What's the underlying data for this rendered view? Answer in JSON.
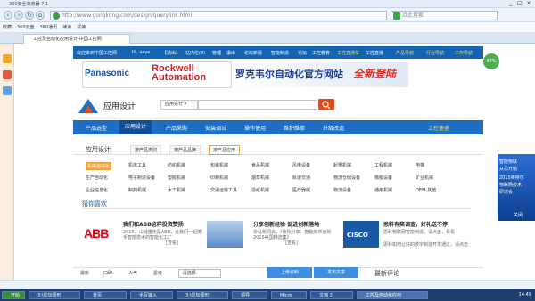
{
  "browser": {
    "title": "360安全浏览器 7.1",
    "address": "http://www.gongkong.com/design/querylink.html",
    "search_placeholder": "点此搜索",
    "favorites": [
      "收藏",
      "360云盘",
      "360通讯",
      "读读",
      "试读"
    ],
    "tab_label": "工控及自动化应用设计-中国工控网",
    "window_controls": [
      "_",
      "□",
      "×"
    ]
  },
  "top_strip": {
    "links": [
      "欢迎来到中国工控网",
      "Hi, vaye",
      "【退出】",
      "站内信(0)",
      "管理",
      "退出",
      "论坛新版",
      "智能制造",
      "论坛",
      "工控教育",
      "工控直通车",
      "工控直播"
    ],
    "right": [
      "产品导航",
      "行业导航",
      "工作导航"
    ]
  },
  "ads": {
    "panasonic": "Panasonic",
    "rockwell_1": "Rockwell",
    "rockwell_2": "Automation",
    "ad_text": "罗克韦尔自动化官方网站",
    "ad_new": "全新登陆"
  },
  "site": {
    "name": "应用设计",
    "select_label": "应用设计 ▾"
  },
  "main_nav": [
    "产品选型",
    "应用设计",
    "产品采购",
    "安装调试",
    "操作使用",
    "维护维修",
    "升级改造",
    "工控速递"
  ],
  "subnav": {
    "title": "应用设计",
    "tabs": [
      "按产品类别",
      "按产品品牌",
      "按产品应用"
    ]
  },
  "categories": {
    "rows": [
      [
        "机械自动化",
        "机床工具",
        "纺织机械",
        "包装机械",
        "食品机械",
        "风电设备",
        "起重机械",
        "工程机械",
        "电梯"
      ],
      [
        "生产自动化",
        "电子制造设备",
        "塑胶机械",
        "印刷机械",
        "烟草机械",
        "轨道交通",
        "物流仓储设备",
        "橡胶设备",
        "矿业机械"
      ],
      [
        "企业信息化",
        "制药机械",
        "木工机械",
        "交通运输工具",
        "造纸机械",
        "医疗器械",
        "物流设备",
        "通用机械",
        "OEM-其他"
      ]
    ],
    "left_labels": [
      "机械自动化",
      "生产自动化",
      "企业信息化"
    ]
  },
  "recommend_title": "猜你喜欢",
  "cards": [
    {
      "title": "ABB",
      "logo": "ABB",
      "headline": "我们和ABB这样投资赞扬",
      "text1": "2015，山城重庆是ABB，让我们一起携手智能技术的智能化工厂",
      "text2": "[查看]"
    },
    {
      "title": "分享创新经验 促进创新落地",
      "headline": "分享创新经验 促进创新落地",
      "text1": "杂乱新闻会，《快快分享：智能城市创新2015美国精选集》",
      "text2": "[查看]"
    },
    {
      "title": "CISCO",
      "logo": "CISCO",
      "headline": "思科有奖调查，好礼送不停",
      "text1": "思科物联网智能制造，请点击，看看",
      "text2": "思科如何让好的数字制造开发通过，请点击"
    }
  ],
  "footer": {
    "sorts": [
      "最新",
      "口碑",
      "人气",
      "星级"
    ],
    "select": "-请选择-",
    "upload": "上传资料",
    "publish": "发布文章",
    "latest": "最新评论"
  },
  "side": {
    "gauge": "47%",
    "ad_lines": [
      "智能物联",
      "从芯开始",
      "2015英特尔",
      "物联网技术",
      "研讨会"
    ],
    "close": "关闭"
  },
  "taskbar": {
    "items": [
      "开始",
      "3:\\论坛图形",
      "首页",
      "手写输入",
      "3:\\论坛图形",
      "领导",
      "Micro",
      "文档 2",
      "工控及自动化应用"
    ],
    "clock": "14:49"
  },
  "colors": {
    "brand_blue": "#1c6fc4",
    "accent_orange": "#e64a19",
    "abb_red": "#e2001a"
  }
}
